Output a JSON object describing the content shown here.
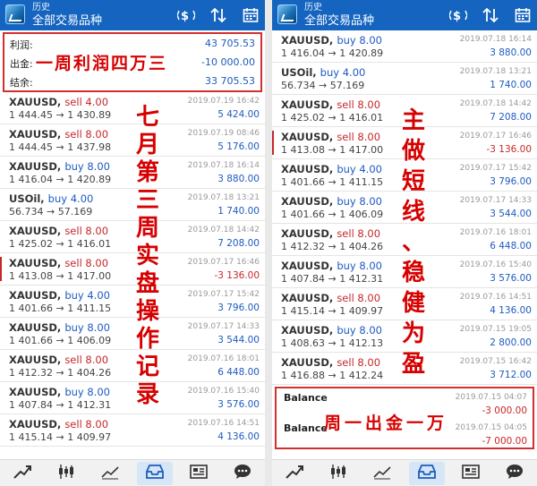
{
  "header": {
    "history_label": "历史",
    "title": "全部交易品种"
  },
  "left": {
    "summary": [
      {
        "label": "利润:",
        "value": "43 705.53"
      },
      {
        "label": "出金:",
        "value": "-10 000.00"
      },
      {
        "label": "结余:",
        "value": "33 705.53"
      }
    ],
    "trades": [
      {
        "symbol": "XAUUSD,",
        "side": "sell 4.00",
        "dir": "sell",
        "prices": "1 444.45 → 1 430.89",
        "date": "2019.07.19 16:42",
        "pl": "5 424.00",
        "pl_sign": "pos"
      },
      {
        "symbol": "XAUUSD,",
        "side": "sell 8.00",
        "dir": "sell",
        "prices": "1 444.45 → 1 437.98",
        "date": "2019.07.19 08:46",
        "pl": "5 176.00",
        "pl_sign": "pos"
      },
      {
        "symbol": "XAUUSD,",
        "side": "buy 8.00",
        "dir": "buy",
        "prices": "1 416.04 → 1 420.89",
        "date": "2019.07.18 16:14",
        "pl": "3 880.00",
        "pl_sign": "pos"
      },
      {
        "symbol": "USOil,",
        "side": "buy 4.00",
        "dir": "buy",
        "prices": "56.734 → 57.169",
        "date": "2019.07.18 13:21",
        "pl": "1 740.00",
        "pl_sign": "pos"
      },
      {
        "symbol": "XAUUSD,",
        "side": "sell 8.00",
        "dir": "sell",
        "prices": "1 425.02 → 1 416.01",
        "date": "2019.07.18 14:42",
        "pl": "7 208.00",
        "pl_sign": "pos"
      },
      {
        "symbol": "XAUUSD,",
        "side": "sell 8.00",
        "dir": "sell",
        "prices": "1 413.08 → 1 417.00",
        "date": "2019.07.17 16:46",
        "pl": "-3 136.00",
        "pl_sign": "neg",
        "marked": true
      },
      {
        "symbol": "XAUUSD,",
        "side": "buy 4.00",
        "dir": "buy",
        "prices": "1 401.66 → 1 411.15",
        "date": "2019.07.17 15:42",
        "pl": "3 796.00",
        "pl_sign": "pos"
      },
      {
        "symbol": "XAUUSD,",
        "side": "buy 8.00",
        "dir": "buy",
        "prices": "1 401.66 → 1 406.09",
        "date": "2019.07.17 14:33",
        "pl": "3 544.00",
        "pl_sign": "pos"
      },
      {
        "symbol": "XAUUSD,",
        "side": "sell 8.00",
        "dir": "sell",
        "prices": "1 412.32 → 1 404.26",
        "date": "2019.07.16 18:01",
        "pl": "6 448.00",
        "pl_sign": "pos"
      },
      {
        "symbol": "XAUUSD,",
        "side": "buy 8.00",
        "dir": "buy",
        "prices": "1 407.84 → 1 412.31",
        "date": "2019.07.16 15:40",
        "pl": "3 576.00",
        "pl_sign": "pos"
      },
      {
        "symbol": "XAUUSD,",
        "side": "sell 8.00",
        "dir": "sell",
        "prices": "1 415.14 → 1 409.97",
        "date": "2019.07.16 14:51",
        "pl": "4 136.00",
        "pl_sign": "pos"
      }
    ],
    "annotation_top": "一周利润四万三",
    "annotation_side": "七月第三周实盘操作记录"
  },
  "right": {
    "trades": [
      {
        "symbol": "XAUUSD,",
        "side": "buy 8.00",
        "dir": "buy",
        "prices": "1 416.04 → 1 420.89",
        "date": "2019.07.18 16:14",
        "pl": "3 880.00",
        "pl_sign": "pos"
      },
      {
        "symbol": "USOil,",
        "side": "buy 4.00",
        "dir": "buy",
        "prices": "56.734 → 57.169",
        "date": "2019.07.18 13:21",
        "pl": "1 740.00",
        "pl_sign": "pos"
      },
      {
        "symbol": "XAUUSD,",
        "side": "sell 8.00",
        "dir": "sell",
        "prices": "1 425.02 → 1 416.01",
        "date": "2019.07.18 14:42",
        "pl": "7 208.00",
        "pl_sign": "pos"
      },
      {
        "symbol": "XAUUSD,",
        "side": "sell 8.00",
        "dir": "sell",
        "prices": "1 413.08 → 1 417.00",
        "date": "2019.07.17 16:46",
        "pl": "-3 136.00",
        "pl_sign": "neg",
        "marked": true
      },
      {
        "symbol": "XAUUSD,",
        "side": "buy 4.00",
        "dir": "buy",
        "prices": "1 401.66 → 1 411.15",
        "date": "2019.07.17 15:42",
        "pl": "3 796.00",
        "pl_sign": "pos"
      },
      {
        "symbol": "XAUUSD,",
        "side": "buy 8.00",
        "dir": "buy",
        "prices": "1 401.66 → 1 406.09",
        "date": "2019.07.17 14:33",
        "pl": "3 544.00",
        "pl_sign": "pos"
      },
      {
        "symbol": "XAUUSD,",
        "side": "sell 8.00",
        "dir": "sell",
        "prices": "1 412.32 → 1 404.26",
        "date": "2019.07.16 18:01",
        "pl": "6 448.00",
        "pl_sign": "pos"
      },
      {
        "symbol": "XAUUSD,",
        "side": "buy 8.00",
        "dir": "buy",
        "prices": "1 407.84 → 1 412.31",
        "date": "2019.07.16 15:40",
        "pl": "3 576.00",
        "pl_sign": "pos"
      },
      {
        "symbol": "XAUUSD,",
        "side": "sell 8.00",
        "dir": "sell",
        "prices": "1 415.14 → 1 409.97",
        "date": "2019.07.16 14:51",
        "pl": "4 136.00",
        "pl_sign": "pos"
      },
      {
        "symbol": "XAUUSD,",
        "side": "buy 8.00",
        "dir": "buy",
        "prices": "1 408.63 → 1 412.13",
        "date": "2019.07.15 19:05",
        "pl": "2 800.00",
        "pl_sign": "pos"
      },
      {
        "symbol": "XAUUSD,",
        "side": "sell 8.00",
        "dir": "sell",
        "prices": "1 416.88 → 1 412.24",
        "date": "2019.07.15 16:42",
        "pl": "3 712.00",
        "pl_sign": "pos"
      }
    ],
    "balances": [
      {
        "label": "Balance",
        "date": "2019.07.15 04:07",
        "value": "-3 000.00"
      },
      {
        "label": "Balance",
        "date": "2019.07.15 04:05",
        "value": "-7 000.00"
      }
    ],
    "annotation_bottom": "周一出金一万",
    "annotation_side": "主做短线、稳健为盈"
  },
  "colors": {
    "topbar": "#1565c0",
    "sell": "#c62828",
    "buy": "#1e5bbf",
    "annotation": "#d60000"
  },
  "nav_icons": [
    "trend-icon",
    "candles-icon",
    "chart-icon",
    "inbox-icon",
    "news-icon",
    "chat-icon"
  ]
}
